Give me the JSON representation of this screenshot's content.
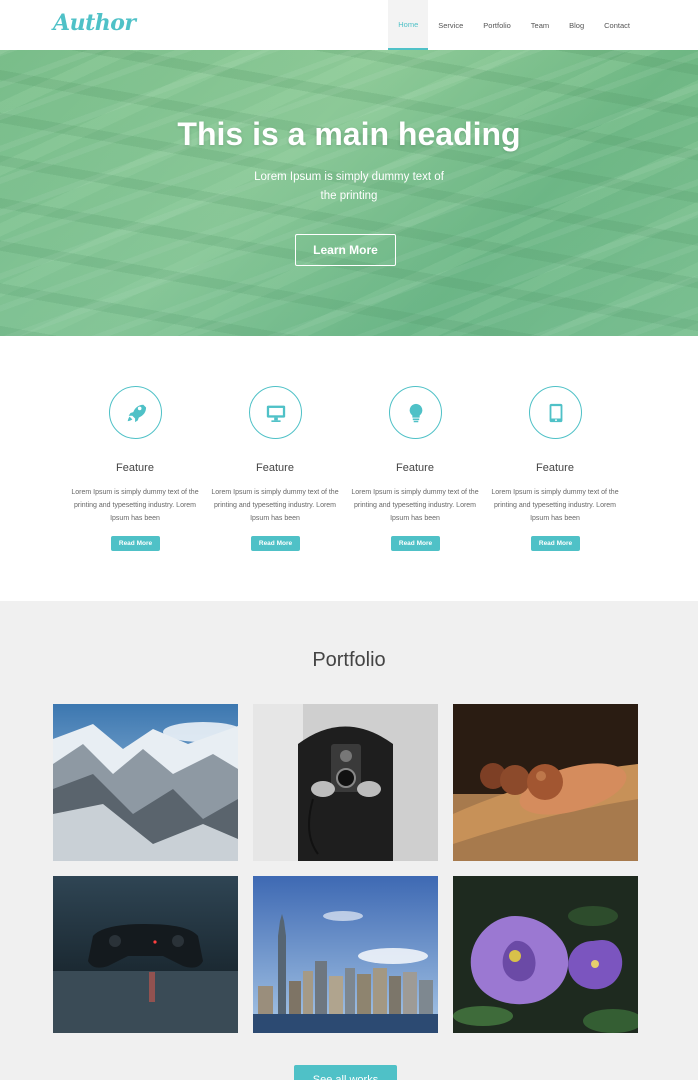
{
  "header": {
    "logo": "Author",
    "nav": [
      {
        "label": "Home",
        "active": true
      },
      {
        "label": "Service"
      },
      {
        "label": "Portfolio"
      },
      {
        "label": "Team"
      },
      {
        "label": "Blog"
      },
      {
        "label": "Contact"
      }
    ]
  },
  "hero": {
    "title": "This is a main heading",
    "subtitle": "Lorem Ipsum is simply dummy text of the printing",
    "button": "Learn More"
  },
  "features": [
    {
      "icon": "rocket-icon",
      "title": "Feature",
      "text": "Lorem Ipsum is simply dummy text of the printing and typesetting industry. Lorem Ipsum has been",
      "button": "Read More"
    },
    {
      "icon": "monitor-icon",
      "title": "Feature",
      "text": "Lorem Ipsum is simply dummy text of the printing and typesetting industry. Lorem Ipsum has been",
      "button": "Read More"
    },
    {
      "icon": "lightbulb-icon",
      "title": "Feature",
      "text": "Lorem Ipsum is simply dummy text of the printing and typesetting industry. Lorem Ipsum has been",
      "button": "Read More"
    },
    {
      "icon": "tablet-icon",
      "title": "Feature",
      "text": "Lorem Ipsum is simply dummy text of the printing and typesetting industry. Lorem Ipsum has been",
      "button": "Read More"
    }
  ],
  "portfolio": {
    "title": "Portfolio",
    "items": [
      {
        "name": "mountains-photo"
      },
      {
        "name": "camera-photo"
      },
      {
        "name": "seeds-photo"
      },
      {
        "name": "gamepad-photo"
      },
      {
        "name": "city-skyline-photo"
      },
      {
        "name": "purple-flowers-photo"
      }
    ],
    "see_all": "See all works"
  },
  "colors": {
    "accent": "#4fc1c7",
    "portfolio_bg": "#f0f0f0"
  }
}
